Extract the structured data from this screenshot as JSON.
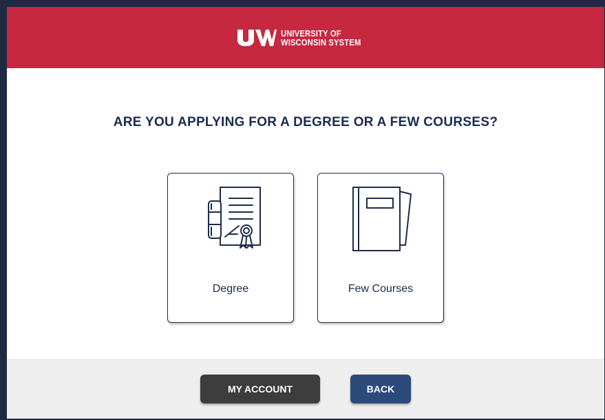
{
  "header": {
    "logo_mark": "UW",
    "logo_line1": "UNIVERSITY OF",
    "logo_line2": "WISCONSIN SYSTEM"
  },
  "main": {
    "question": "ARE YOU APPLYING FOR A DEGREE OR A FEW COURSES?",
    "options": [
      {
        "label": "Degree",
        "icon": "diploma-icon"
      },
      {
        "label": "Few Courses",
        "icon": "book-icon"
      }
    ]
  },
  "footer": {
    "my_account_label": "MY ACCOUNT",
    "back_label": "BACK"
  },
  "colors": {
    "header_red": "#c5283f",
    "navy": "#1a2b4c",
    "dark_button": "#3d3d3d",
    "back_button": "#2c4a7a"
  }
}
